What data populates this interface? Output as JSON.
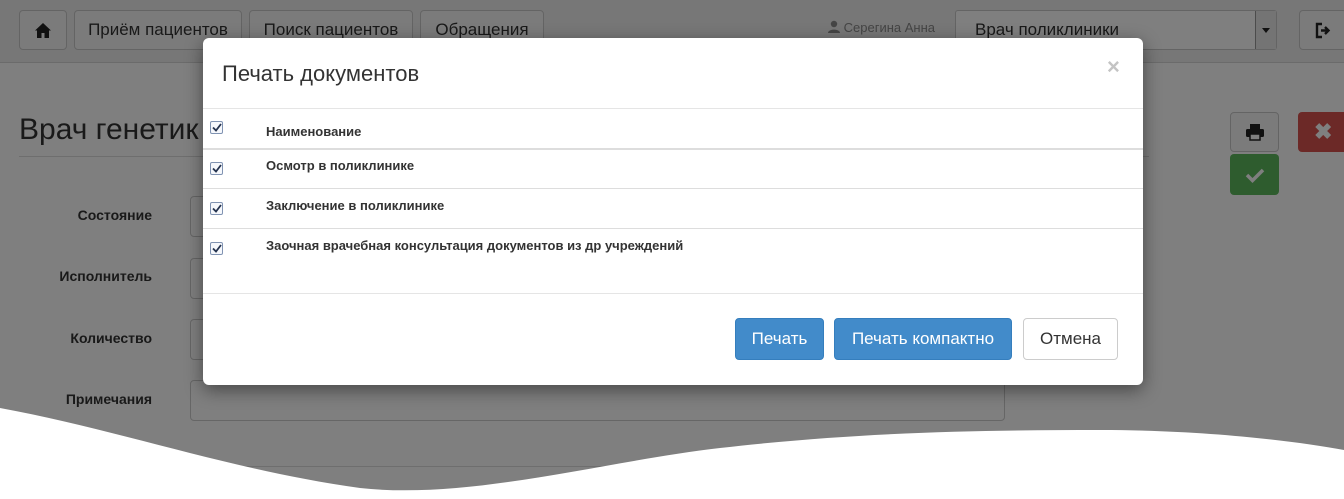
{
  "topbar": {
    "home_icon": "home-icon",
    "nav": [
      "Приём пациентов",
      "Поиск пациентов",
      "Обращения"
    ],
    "user_name": "Серегина Анна",
    "user_icon": "user-icon",
    "role_value": "Врач поликлиники",
    "logout_icon": "logout-icon"
  },
  "page": {
    "title": "Врач генетик",
    "print_icon": "printer-icon",
    "close_icon": "close-icon",
    "ok_icon": "checkmark-icon",
    "fields": [
      "Состояние",
      "Исполнитель",
      "Количество",
      "Примечания"
    ]
  },
  "modal": {
    "title": "Печать документов",
    "close_glyph": "×",
    "table": {
      "header": "Наименование",
      "header_checked": true,
      "rows": [
        {
          "name": "Осмотр в поликлинике",
          "checked": true
        },
        {
          "name": "Заключение в поликлинике",
          "checked": true
        },
        {
          "name": "Заочная врачебная консультация документов из др учреждений",
          "checked": true
        }
      ]
    },
    "buttons": {
      "print": "Печать",
      "print_compact": "Печать компактно",
      "cancel": "Отмена"
    }
  },
  "colors": {
    "primary": "#428bca",
    "danger": "#d9534f",
    "success": "#5cb85c",
    "overlay": "rgba(0,0,0,0.5)"
  }
}
